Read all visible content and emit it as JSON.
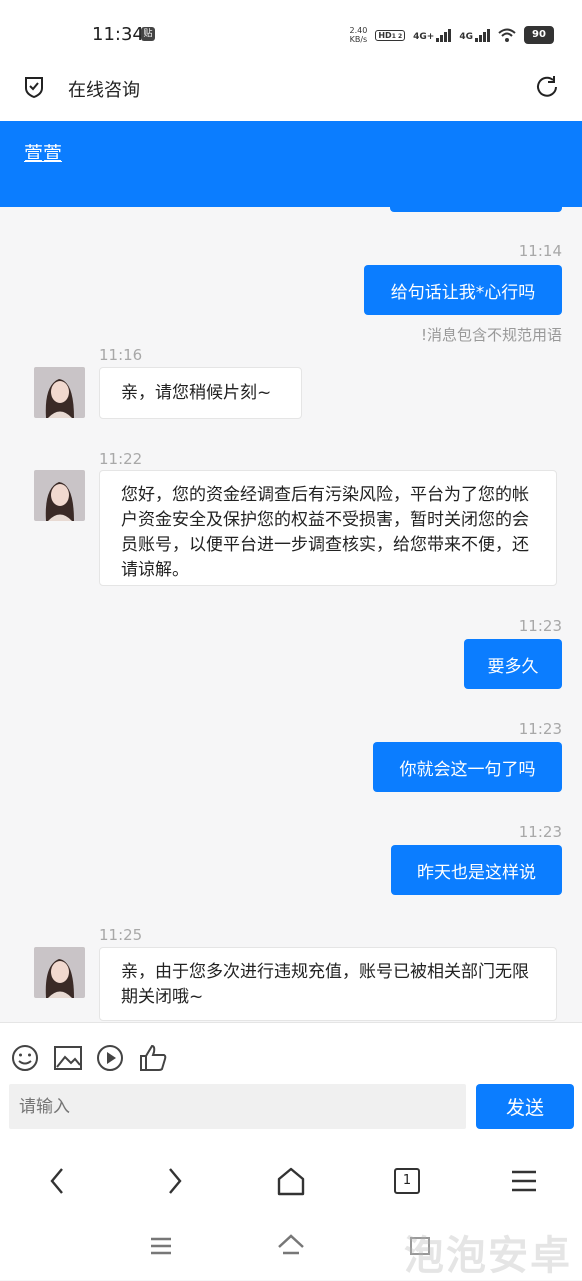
{
  "status": {
    "time": "11:34",
    "tie_badge": "贴",
    "net_speed_value": "2.40",
    "net_speed_unit": "KB/s",
    "hd": "HD",
    "hd_sub": "1 2",
    "sig1": "4G+",
    "sig2": "4G",
    "battery": "90"
  },
  "header": {
    "title": "在线咨询"
  },
  "agent": {
    "name": "萱萱"
  },
  "messages": [
    {
      "time": "11:14",
      "text": "给句话让我*心行吗",
      "warning": "!消息包含不规范用语"
    },
    {
      "time": "11:16",
      "text": "亲，请您稍候片刻~"
    },
    {
      "time": "11:22",
      "text": "您好，您的资金经调查后有污染风险，平台为了您的帐户资金安全及保护您的权益不受损害，暂时关闭您的会员账号，以便平台进一步调查核实，给您带来不便，还请谅解。"
    },
    {
      "time": "11:23",
      "text": "要多久"
    },
    {
      "time": "11:23",
      "text": "你就会这一句了吗"
    },
    {
      "time": "11:23",
      "text": "昨天也是这样说"
    },
    {
      "time": "11:25",
      "text": "亲，由于您多次进行违规充值，账号已被相关部门无限期关闭哦~"
    }
  ],
  "composer": {
    "placeholder": "请输入",
    "send_label": "发送"
  },
  "browser": {
    "tab_count": "1"
  },
  "watermark": "泡泡安卓",
  "icons": [
    "shield-check-icon",
    "refresh-icon",
    "emoji-icon",
    "image-icon",
    "video-icon",
    "thumbs-up-icon",
    "back-icon",
    "forward-icon",
    "home-icon",
    "tabs-icon",
    "menu-icon"
  ],
  "colors": {
    "accent": "#0b7dff",
    "background": "#f6f6f7"
  }
}
